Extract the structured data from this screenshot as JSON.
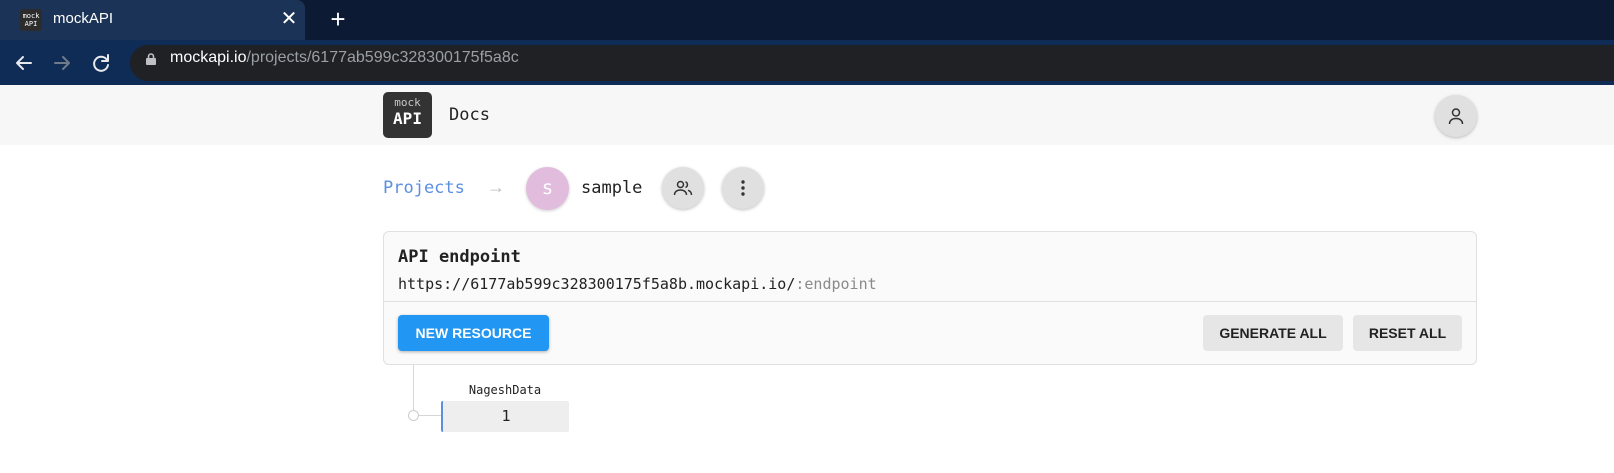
{
  "browser": {
    "tab": {
      "title": "mockAPI",
      "favicon_top": "mock",
      "favicon_bottom": "API",
      "close_glyph": "✕"
    },
    "new_tab_glyph": "+",
    "address": {
      "host": "mockapi.io",
      "path": "/projects/6177ab599c328300175f5a8c"
    }
  },
  "header": {
    "logo_top": "mock",
    "logo_bottom": "API",
    "docs_label": "Docs",
    "user_icon": "user-icon"
  },
  "breadcrumb": {
    "projects_label": "Projects",
    "arrow": "→",
    "project_initial": "s",
    "project_name": "sample",
    "members_icon": "users-icon",
    "more_icon": "more-vertical-icon"
  },
  "endpoint_card": {
    "title": "API endpoint",
    "url_base": "https://6177ab599c328300175f5a8b.mockapi.io/",
    "url_suffix": ":endpoint",
    "new_resource_label": "NEW RESOURCE",
    "generate_all_label": "GENERATE ALL",
    "reset_all_label": "RESET ALL"
  },
  "resources": [
    {
      "name": "NageshData",
      "count": "1"
    }
  ],
  "colors": {
    "tabbar": "#0c1a33",
    "toolbar": "#0e2c55",
    "accent_blue": "#2196f3",
    "link_blue": "#5b8fe0",
    "avatar_pink": "#e1bcdd"
  }
}
